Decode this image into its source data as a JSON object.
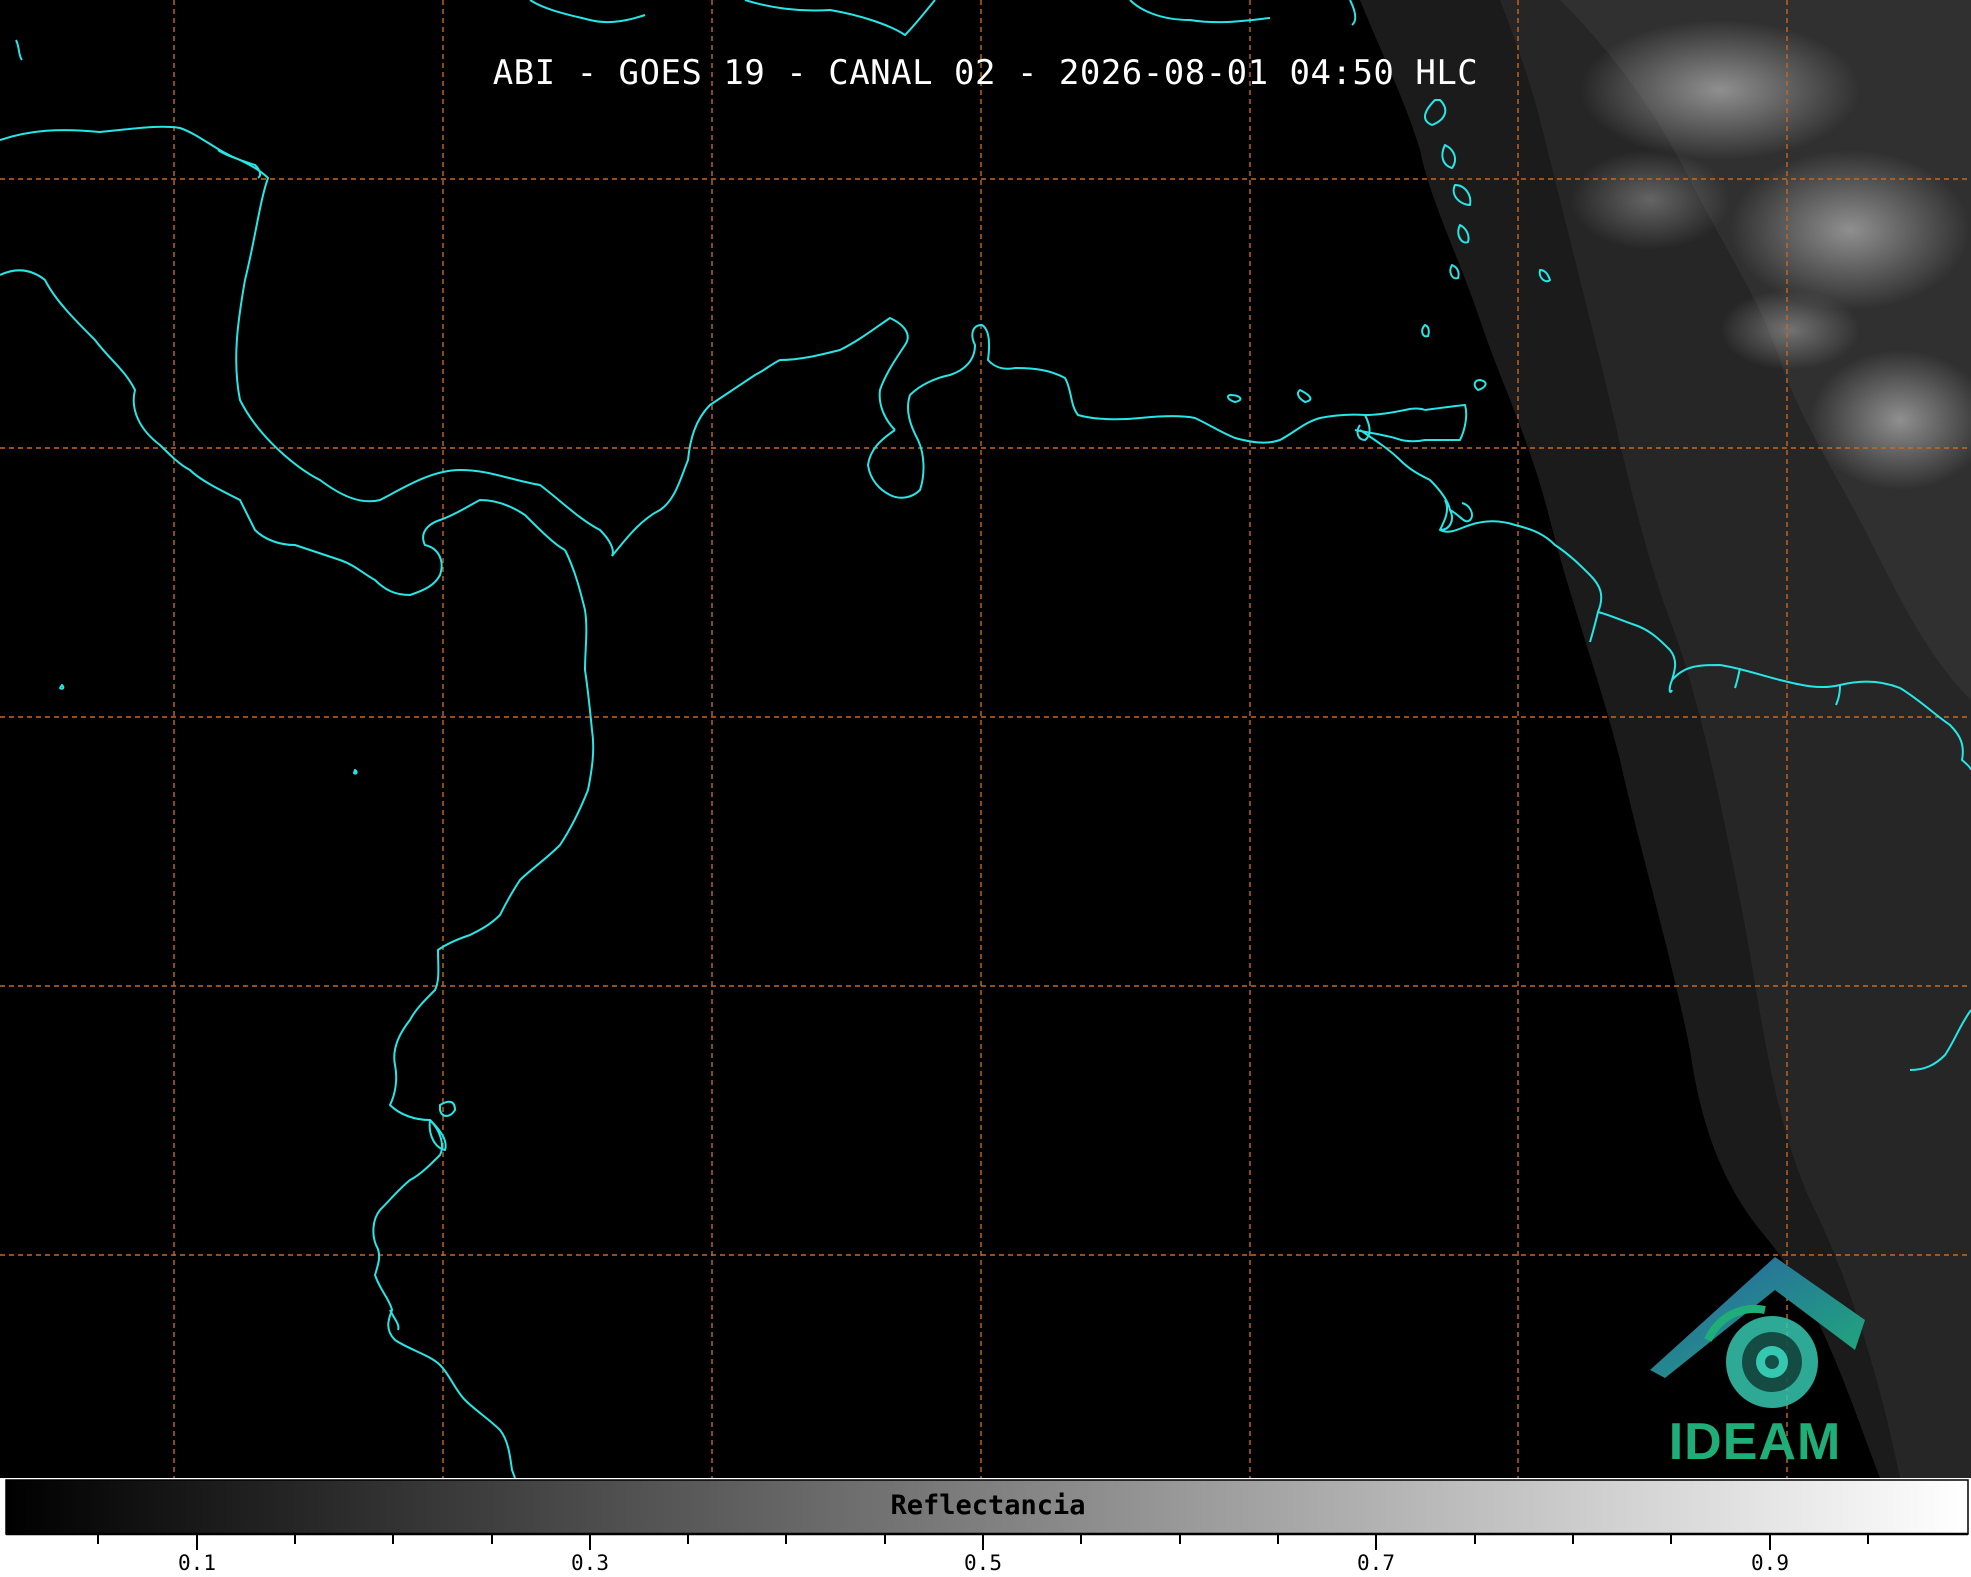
{
  "title": "ABI - GOES 19 - CANAL 02 - 2026-08-01 04:50 HLC",
  "logo": {
    "text": "IDEAM",
    "colors": [
      "#2a5fa6",
      "#1fae78",
      "#35c7b0"
    ]
  },
  "colorbar": {
    "label": "Reflectancia",
    "range": [
      0.0,
      1.0
    ],
    "ticks": [
      "0.1",
      "0.3",
      "0.5",
      "0.7",
      "0.9"
    ],
    "colormap": [
      "#000000",
      "#ffffff"
    ]
  },
  "map": {
    "background": "#000000",
    "coastline_color": "#27e6e6",
    "gridline_color": "#c8681e",
    "gridline_style": "dashed"
  }
}
